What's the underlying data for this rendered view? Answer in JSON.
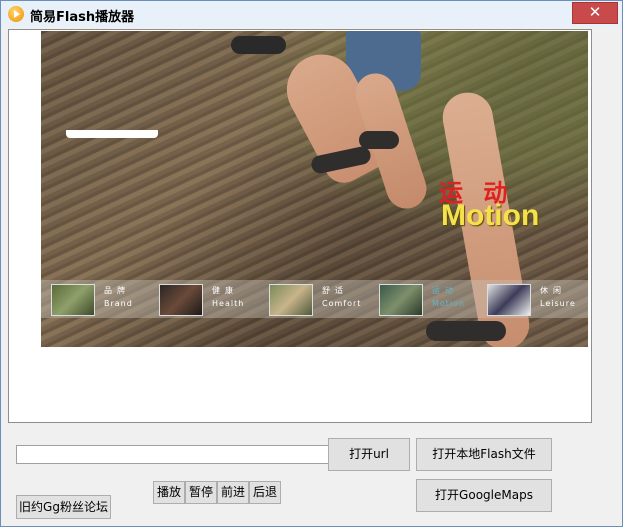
{
  "window": {
    "title": "简易Flash播放器",
    "close_glyph": "✕"
  },
  "flash": {
    "headline_cn": "运 动",
    "headline_en": "Motion",
    "nav_items": [
      {
        "cn": "品牌",
        "en": "Brand",
        "active": false
      },
      {
        "cn": "健康",
        "en": "Health",
        "active": false
      },
      {
        "cn": "舒适",
        "en": "Comfort",
        "active": false
      },
      {
        "cn": "运动",
        "en": "Motion",
        "active": true
      },
      {
        "cn": "休闲",
        "en": "Leisure",
        "active": false
      }
    ]
  },
  "controls": {
    "url_value": "",
    "open_url_label": "打开url",
    "open_local_label": "打开本地Flash文件",
    "open_maps_label": "打开GoogleMaps",
    "play_label": "播放",
    "pause_label": "暂停",
    "forward_label": "前进",
    "back_label": "后退",
    "forum_label": "旧约Gg粉丝论坛"
  },
  "colors": {
    "accent_red": "#e02020",
    "accent_yellow": "#f5e24a",
    "nav_active": "#5fb8c9"
  }
}
